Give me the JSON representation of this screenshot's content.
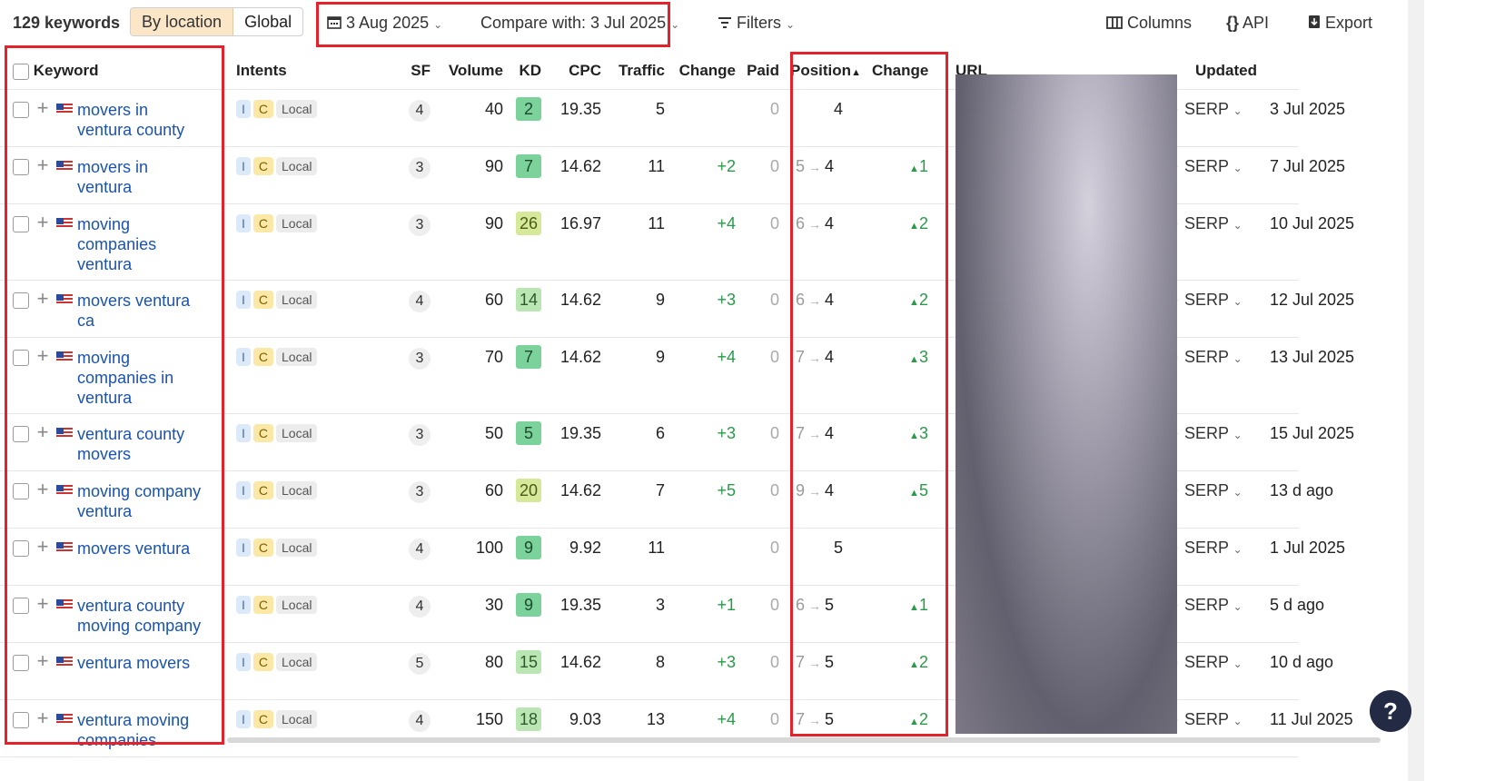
{
  "toolbar": {
    "count": "129 keywords",
    "by_location": "By location",
    "global": "Global",
    "date": "3 Aug 2025",
    "compare": "Compare with: 3 Jul 2025",
    "filters": "Filters",
    "columns": "Columns",
    "api": "API",
    "export": "Export"
  },
  "headers": {
    "keyword": "Keyword",
    "intents": "Intents",
    "sf": "SF",
    "volume": "Volume",
    "kd": "KD",
    "cpc": "CPC",
    "traffic": "Traffic",
    "change": "Change",
    "paid": "Paid",
    "position": "Position",
    "pos_change": "Change",
    "url": "URL",
    "updated": "Updated"
  },
  "intent_labels": {
    "i": "I",
    "c": "C",
    "local": "Local"
  },
  "serp_label": "SERP",
  "rows": [
    {
      "keyword": "movers in ventura county",
      "sf": "4",
      "volume": "40",
      "kd": "2",
      "kd_color": "green",
      "cpc": "19.35",
      "traffic": "5",
      "change": "",
      "paid": "0",
      "pos_from": "",
      "pos_to": "4",
      "pos_change": "",
      "updated": "3 Jul 2025"
    },
    {
      "keyword": "movers in ventura",
      "sf": "3",
      "volume": "90",
      "kd": "7",
      "kd_color": "green",
      "cpc": "14.62",
      "traffic": "11",
      "change": "+2",
      "paid": "0",
      "pos_from": "5",
      "pos_to": "4",
      "pos_change": "1",
      "updated": "7 Jul 2025"
    },
    {
      "keyword": "moving companies ventura",
      "sf": "3",
      "volume": "90",
      "kd": "26",
      "kd_color": "ol",
      "cpc": "16.97",
      "traffic": "11",
      "change": "+4",
      "paid": "0",
      "pos_from": "6",
      "pos_to": "4",
      "pos_change": "2",
      "updated": "10 Jul 2025"
    },
    {
      "keyword": "movers ventura ca",
      "sf": "4",
      "volume": "60",
      "kd": "14",
      "kd_color": "lg",
      "cpc": "14.62",
      "traffic": "9",
      "change": "+3",
      "paid": "0",
      "pos_from": "6",
      "pos_to": "4",
      "pos_change": "2",
      "updated": "12 Jul 2025"
    },
    {
      "keyword": "moving companies in ventura",
      "sf": "3",
      "volume": "70",
      "kd": "7",
      "kd_color": "green",
      "cpc": "14.62",
      "traffic": "9",
      "change": "+4",
      "paid": "0",
      "pos_from": "7",
      "pos_to": "4",
      "pos_change": "3",
      "updated": "13 Jul 2025"
    },
    {
      "keyword": "ventura county movers",
      "sf": "3",
      "volume": "50",
      "kd": "5",
      "kd_color": "green",
      "cpc": "19.35",
      "traffic": "6",
      "change": "+3",
      "paid": "0",
      "pos_from": "7",
      "pos_to": "4",
      "pos_change": "3",
      "updated": "15 Jul 2025"
    },
    {
      "keyword": "moving company ventura",
      "sf": "3",
      "volume": "60",
      "kd": "20",
      "kd_color": "ol",
      "cpc": "14.62",
      "traffic": "7",
      "change": "+5",
      "paid": "0",
      "pos_from": "9",
      "pos_to": "4",
      "pos_change": "5",
      "updated": "13 d ago"
    },
    {
      "keyword": "movers ventura",
      "sf": "4",
      "volume": "100",
      "kd": "9",
      "kd_color": "green",
      "cpc": "9.92",
      "traffic": "11",
      "change": "",
      "paid": "0",
      "pos_from": "",
      "pos_to": "5",
      "pos_change": "",
      "updated": "1 Jul 2025"
    },
    {
      "keyword": "ventura county moving company",
      "sf": "4",
      "volume": "30",
      "kd": "9",
      "kd_color": "green",
      "cpc": "19.35",
      "traffic": "3",
      "change": "+1",
      "paid": "0",
      "pos_from": "6",
      "pos_to": "5",
      "pos_change": "1",
      "updated": "5 d ago"
    },
    {
      "keyword": "ventura movers",
      "sf": "5",
      "volume": "80",
      "kd": "15",
      "kd_color": "lg",
      "cpc": "14.62",
      "traffic": "8",
      "change": "+3",
      "paid": "0",
      "pos_from": "7",
      "pos_to": "5",
      "pos_change": "2",
      "updated": "10 d ago"
    },
    {
      "keyword": "ventura moving companies",
      "sf": "4",
      "volume": "150",
      "kd": "18",
      "kd_color": "lg",
      "cpc": "9.03",
      "traffic": "13",
      "change": "+4",
      "paid": "0",
      "pos_from": "7",
      "pos_to": "5",
      "pos_change": "2",
      "updated": "11 Jul 2025"
    }
  ]
}
